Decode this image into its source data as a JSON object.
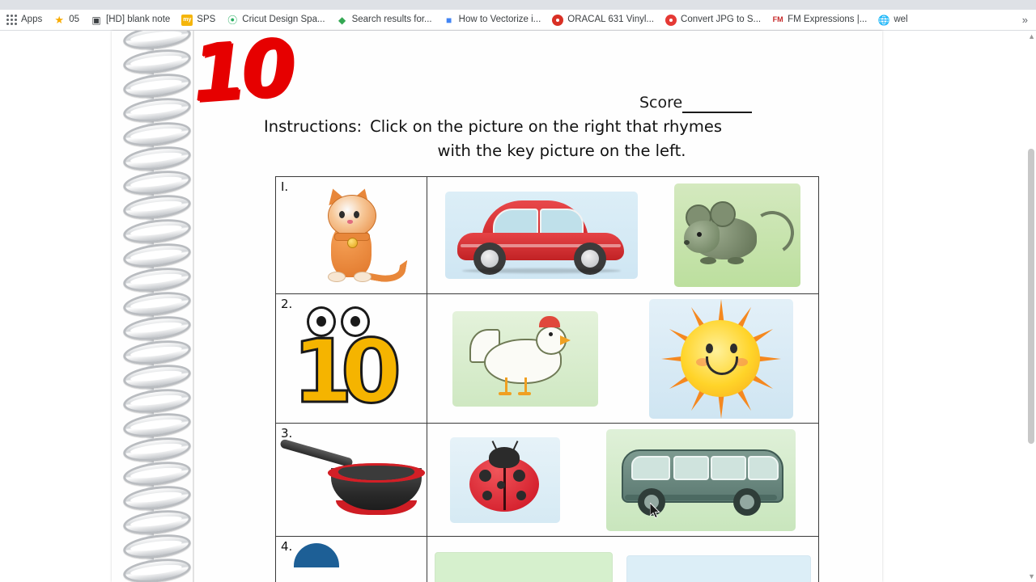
{
  "browser": {
    "bookmarks": [
      {
        "label": "Apps",
        "icon": "apps-grid-icon"
      },
      {
        "label": "05",
        "icon": "star-icon"
      },
      {
        "label": "[HD] blank note",
        "icon": "camera-icon"
      },
      {
        "label": "SPS",
        "icon": "my-icon"
      },
      {
        "label": "Cricut Design Spa...",
        "icon": "cricut-icon"
      },
      {
        "label": "Search results for...",
        "icon": "google-search-icon"
      },
      {
        "label": "How to Vectorize i...",
        "icon": "document-icon"
      },
      {
        "label": "ORACAL 631 Vinyl...",
        "icon": "red-circle-icon"
      },
      {
        "label": "Convert JPG to S...",
        "icon": "red-badge-icon"
      },
      {
        "label": "FM Expressions |...",
        "icon": "fm-icon"
      },
      {
        "label": "wel",
        "icon": "globe-icon"
      }
    ],
    "overflow_label": "»"
  },
  "worksheet": {
    "handwritten_score_mark": "10",
    "score_label": "Score",
    "instructions_lead": "Instructions:",
    "instructions_line1": "Click on the picture on the right that rhymes",
    "instructions_line2": "with the key picture on the left.",
    "rows": [
      {
        "number": "I.",
        "key": {
          "name": "cat-picture",
          "alt": "cat"
        },
        "options": [
          {
            "name": "car-picture",
            "alt": "car"
          },
          {
            "name": "mouse-picture",
            "alt": "mouse"
          }
        ]
      },
      {
        "number": "2.",
        "key": {
          "name": "ten-picture",
          "alt": "ten"
        },
        "options": [
          {
            "name": "hen-picture",
            "alt": "hen"
          },
          {
            "name": "sun-picture",
            "alt": "sun"
          }
        ]
      },
      {
        "number": "3.",
        "key": {
          "name": "pan-picture",
          "alt": "pan"
        },
        "options": [
          {
            "name": "bug-picture",
            "alt": "ladybug"
          },
          {
            "name": "van-picture",
            "alt": "van"
          }
        ]
      },
      {
        "number": "4.",
        "key": {
          "name": "partial-picture",
          "alt": "partially visible picture"
        },
        "options": [
          {
            "name": "partial-option-1",
            "alt": "partially visible option"
          },
          {
            "name": "partial-option-2",
            "alt": "partially visible option"
          }
        ]
      }
    ]
  },
  "colors": {
    "red_mark": "#e60000",
    "sheet": "#fefefe",
    "chrome": "#dee1e6",
    "table_border": "#3a3a3a"
  }
}
